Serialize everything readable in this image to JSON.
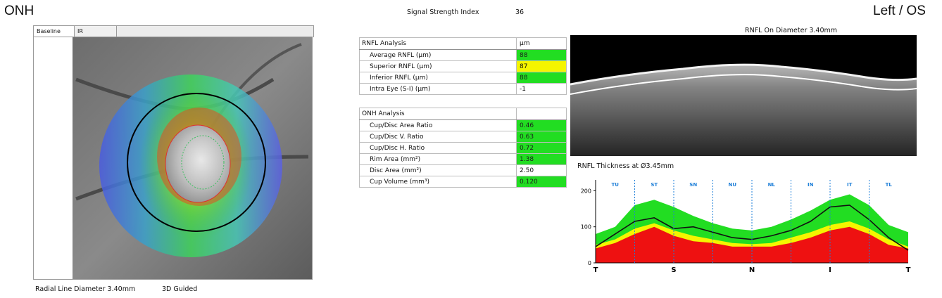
{
  "header": {
    "left_title": "ONH",
    "signal_label": "Signal Strength Index",
    "signal_value": "36",
    "right_title": "Left / OS"
  },
  "tabs": [
    {
      "label": "Baseline",
      "active": true
    },
    {
      "label": "IR",
      "active": false
    }
  ],
  "footer": {
    "radial_line": "Radial Line Diameter 3.40mm",
    "guided": "3D Guided"
  },
  "rnfl_table": {
    "header": "RNFL Analysis",
    "unit": "µm",
    "rows": [
      {
        "label": "Average RNFL (µm)",
        "value": "88",
        "status": "green"
      },
      {
        "label": "Superior RNFL (µm)",
        "value": "87",
        "status": "yellow"
      },
      {
        "label": "Inferior RNFL (µm)",
        "value": "88",
        "status": "green"
      },
      {
        "label": "Intra Eye (S-I) (µm)",
        "value": "-1",
        "status": "white"
      }
    ]
  },
  "onh_table": {
    "header": "ONH Analysis",
    "rows": [
      {
        "label": "Cup/Disc Area Ratio",
        "value": "0.46",
        "status": "green"
      },
      {
        "label": "Cup/Disc V. Ratio",
        "value": "0.63",
        "status": "green"
      },
      {
        "label": "Cup/Disc H. Ratio",
        "value": "0.72",
        "status": "green"
      },
      {
        "label": "Rim Area (mm²)",
        "value": "1.38",
        "status": "green"
      },
      {
        "label": "Disc Area (mm²)",
        "value": "2.50",
        "status": "white"
      },
      {
        "label": "Cup Volume (mm³)",
        "value": "0.120",
        "status": "green"
      }
    ]
  },
  "oct": {
    "title": "RNFL On Diameter 3.40mm"
  },
  "colors": {
    "green": "#22dd22",
    "yellow": "#f5f500",
    "red": "#ee1111",
    "sector_label": "#1e7fd8"
  },
  "chart_data": {
    "type": "area",
    "title": "RNFL Thickness at Ø3.45mm",
    "sectors": [
      "TU",
      "ST",
      "SN",
      "NU",
      "NL",
      "IN",
      "IT",
      "TL"
    ],
    "x_ticks": [
      "T",
      "S",
      "N",
      "I",
      "T"
    ],
    "y_ticks": [
      "0",
      "100",
      "200"
    ],
    "ylim": [
      0,
      230
    ],
    "x": [
      0,
      25,
      50,
      75,
      100,
      125,
      150,
      175,
      200,
      225,
      250,
      275,
      300,
      325,
      350,
      375,
      400
    ],
    "series": [
      {
        "band": "green_upper",
        "values": [
          80,
          100,
          160,
          175,
          155,
          130,
          110,
          95,
          90,
          100,
          120,
          145,
          175,
          190,
          160,
          105,
          85
        ]
      },
      {
        "band": "yellow_upper",
        "values": [
          50,
          65,
          95,
          110,
          90,
          75,
          65,
          55,
          52,
          55,
          70,
          85,
          105,
          115,
          95,
          65,
          45
        ]
      },
      {
        "band": "red_upper",
        "values": [
          40,
          55,
          80,
          100,
          75,
          60,
          55,
          45,
          45,
          45,
          55,
          70,
          90,
          100,
          80,
          50,
          40
        ]
      },
      {
        "name": "measured",
        "values": [
          45,
          80,
          115,
          125,
          95,
          100,
          85,
          70,
          65,
          75,
          90,
          115,
          155,
          160,
          120,
          70,
          35
        ]
      }
    ]
  }
}
